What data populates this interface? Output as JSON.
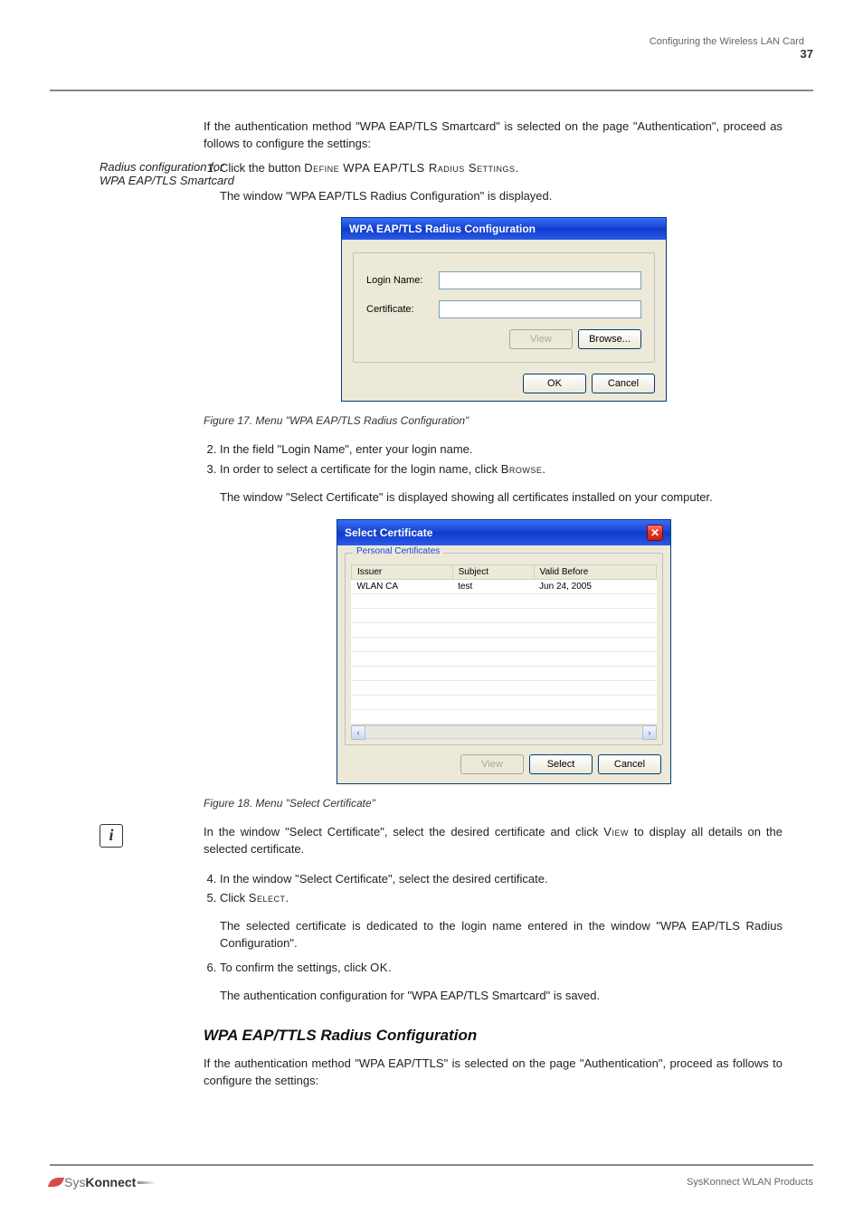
{
  "header": {
    "subtitle": "Configuring the Wireless LAN Card",
    "page_number": "37"
  },
  "section1": {
    "intro": "If the authentication method \"WPA EAP/TLS Smartcard\" is selected on the page \"Authentication\", proceed as follows to configure the settings:",
    "radius_label": "Radius configuration for WPA EAP/TLS Smartcard",
    "steps": [
      "Click the button DEFINE WPA EAP/TLS RADIUS SETTINGS."
    ],
    "after_step": "The window \"WPA EAP/TLS Radius Configuration\" is displayed."
  },
  "dialog1": {
    "title": "WPA EAP/TLS Radius Configuration",
    "fields": {
      "login_label": "Login Name:",
      "login_value": "",
      "cert_label": "Certificate:",
      "cert_value": ""
    },
    "buttons": {
      "view": "View",
      "browse": "Browse...",
      "ok": "OK",
      "cancel": "Cancel"
    }
  },
  "fig1_caption": "Figure 17. Menu \"WPA EAP/TLS Radius Configuration\"",
  "section2": {
    "step_start": 2,
    "steps": [
      "In the field \"Login Name\", enter your login name.",
      "In order to select a certificate for the login name, click BROWSE."
    ],
    "after": "The window \"Select Certificate\" is displayed showing all certificates installed on your computer."
  },
  "dialog2": {
    "title": "Select Certificate",
    "legend": "Personal Certificates",
    "columns": [
      "Issuer",
      "Subject",
      "Valid Before"
    ],
    "rows": [
      {
        "issuer": "WLAN CA",
        "subject": "test",
        "valid": "Jun 24, 2005"
      }
    ],
    "empty_row_count": 9,
    "buttons": {
      "view": "View",
      "select": "Select",
      "cancel": "Cancel"
    }
  },
  "fig2_caption": "Figure 18. Menu \"Select Certificate\"",
  "note": {
    "icon": "i",
    "text": "In the window \"Select Certificate\", select the desired certificate and click VIEW to display all details on the selected certificate."
  },
  "section3": {
    "step_start": 4,
    "steps": [
      "In the window \"Select Certificate\", select the desired certificate.",
      "Click SELECT."
    ],
    "after1": "The selected certificate is dedicated to the login name entered in the window \"WPA EAP/TLS Radius Configuration\".",
    "step6": "To confirm the settings, click OK.",
    "after2": "The authentication configuration for \"WPA EAP/TLS Smartcard\" is saved."
  },
  "heading_ttls": "WPA EAP/TTLS Radius Configuration",
  "section4": {
    "intro": "If the authentication method \"WPA EAP/TTLS\" is selected on the page \"Authentication\", proceed as follows to configure the settings:"
  },
  "footer": {
    "doc_title": "SysKonnect WLAN Products"
  }
}
